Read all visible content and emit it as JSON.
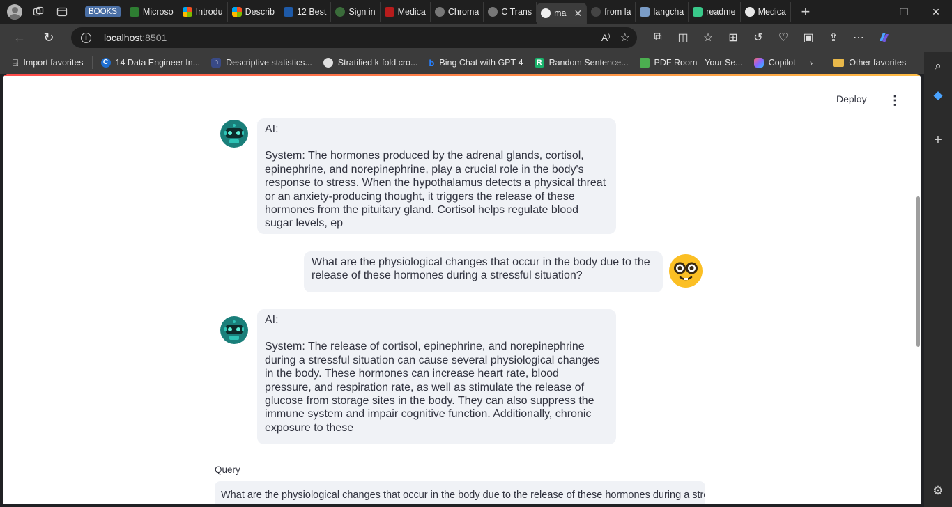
{
  "browser": {
    "tabs": [
      {
        "label": "BOOKS",
        "fav": "#4a6fa5",
        "chip": true
      },
      {
        "label": "Microso",
        "fav": "#2e7d32"
      },
      {
        "label": "Introdu",
        "fav": "#f25022"
      },
      {
        "label": "Describ",
        "fav": "#f25022"
      },
      {
        "label": "12 Best",
        "fav": "#1e5aa8"
      },
      {
        "label": "Sign in",
        "fav": "#3a6b3a"
      },
      {
        "label": "Medica",
        "fav": "#b71c1c"
      },
      {
        "label": "Chroma",
        "fav": "#888888"
      },
      {
        "label": "C Trans",
        "fav": "#888888"
      },
      {
        "label": "ma",
        "fav": "#e8e8e8",
        "active": true
      },
      {
        "label": "from la",
        "fav": "#555555"
      },
      {
        "label": "langcha",
        "fav": "#7a9cc6"
      },
      {
        "label": "readme",
        "fav": "#39c98a"
      },
      {
        "label": "Medica",
        "fav": "#e8e8e8"
      }
    ],
    "new_tab_symbol": "+",
    "url_host": "localhost",
    "url_port": ":8501",
    "favorites": [
      {
        "label": "Import favorites",
        "icon": "import-icon",
        "color": "#cccccc"
      },
      {
        "label": "14 Data Engineer In...",
        "icon": "coursera-icon",
        "color": "#1f6fd1"
      },
      {
        "label": "Descriptive statistics...",
        "icon": "hashnode-icon",
        "color": "#394a86"
      },
      {
        "label": "Stratified k-fold cro...",
        "icon": "openai-icon",
        "color": "#e0e0e0"
      },
      {
        "label": "Bing Chat with GPT-4",
        "icon": "bing-icon",
        "color": "#2680ff"
      },
      {
        "label": "Random Sentence...",
        "icon": "r-icon",
        "color": "#19b36b"
      },
      {
        "label": "PDF Room - Your Se...",
        "icon": "pdfroom-icon",
        "color": "#4caf50"
      },
      {
        "label": "Copilot",
        "icon": "copilot-icon",
        "color": "#8a63ff"
      }
    ],
    "other_favorites": "Other favorites"
  },
  "app": {
    "deploy_label": "Deploy",
    "messages": [
      {
        "role": "ai",
        "speaker": "AI:",
        "text": "System: The hormones produced by the adrenal glands, cortisol,\nepinephrine, and norepinephrine, play a crucial role in the body's\nresponse to stress. When the hypothalamus detects a physical threat\nor an anxiety-producing thought, it triggers the release of these\nhormones from the pituitary gland. Cortisol helps regulate blood\nsugar levels, ep"
      },
      {
        "role": "user",
        "text": "What are the physiological changes that occur in the body due to the\nrelease of these hormones during a stressful situation?"
      },
      {
        "role": "ai",
        "speaker": "AI:",
        "text": "System: The release of cortisol, epinephrine, and norepinephrine\nduring a stressful situation can cause several physiological changes\nin the body. These hormones can increase heart rate, blood\npressure, and respiration rate, as well as stimulate the release of\nglucose from storage sites in the body. They can also suppress the\nimmune system and impair cognitive function. Additionally, chronic\nexposure to these"
      }
    ],
    "query_label": "Query",
    "query_value": "What are the physiological changes that occur in the body due to the release of these hormones during a stressful situation?"
  }
}
